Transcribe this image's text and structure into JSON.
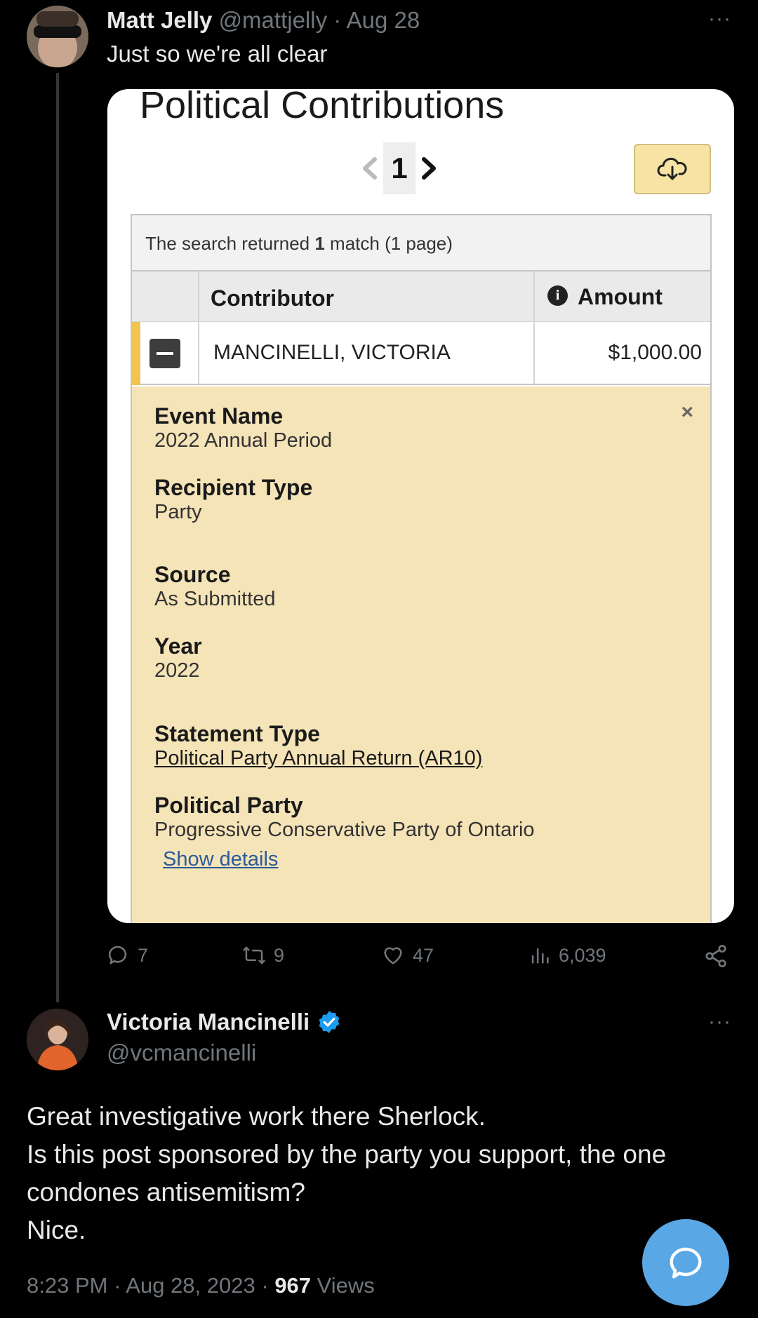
{
  "tweet1": {
    "name": "Matt Jelly",
    "handle": "@mattjelly",
    "separator": "·",
    "date": "Aug 28",
    "text": "Just so we're all clear",
    "more": "···",
    "card": {
      "title": "Political Contributions",
      "page_number": "1",
      "search_prefix": "The search returned ",
      "search_count": "1",
      "search_suffix": " match (1 page)",
      "columns": {
        "contributor": "Contributor",
        "amount": "Amount"
      },
      "row": {
        "contributor": "MANCINELLI, VICTORIA",
        "amount": "$1,000.00"
      },
      "details": {
        "close": "×",
        "event_name_label": "Event Name",
        "event_name_value": "2022 Annual Period",
        "recipient_type_label": "Recipient Type",
        "recipient_type_value": "Party",
        "source_label": "Source",
        "source_value": "As Submitted",
        "year_label": "Year",
        "year_value": "2022",
        "statement_type_label": "Statement Type",
        "statement_type_value": "Political Party Annual Return (AR10)",
        "political_party_label": "Political Party",
        "political_party_value": "Progressive Conservative Party of Ontario",
        "show_details": "Show details"
      },
      "accent_color": "#f0c450",
      "details_bg": "#f5e4b8"
    },
    "stats": {
      "replies": "7",
      "retweets": "9",
      "likes": "47",
      "views": "6,039"
    }
  },
  "tweet2": {
    "name": "Victoria Mancinelli",
    "handle": "@vcmancinelli",
    "more": "···",
    "body_lines": [
      "Great investigative work there Sherlock.",
      "Is this post sponsored by the party you support, the one condones antisemitism?",
      "Nice."
    ],
    "time": "8:23 PM",
    "date": "Aug 28, 2023",
    "views_count": "967",
    "views_label": "Views",
    "verified_color": "#1d9bf0"
  },
  "icons": [
    "reply-icon",
    "retweet-icon",
    "like-icon",
    "views-icon",
    "share-icon",
    "verified-badge-icon",
    "download-cloud-icon",
    "info-icon",
    "chat-fab-icon"
  ]
}
